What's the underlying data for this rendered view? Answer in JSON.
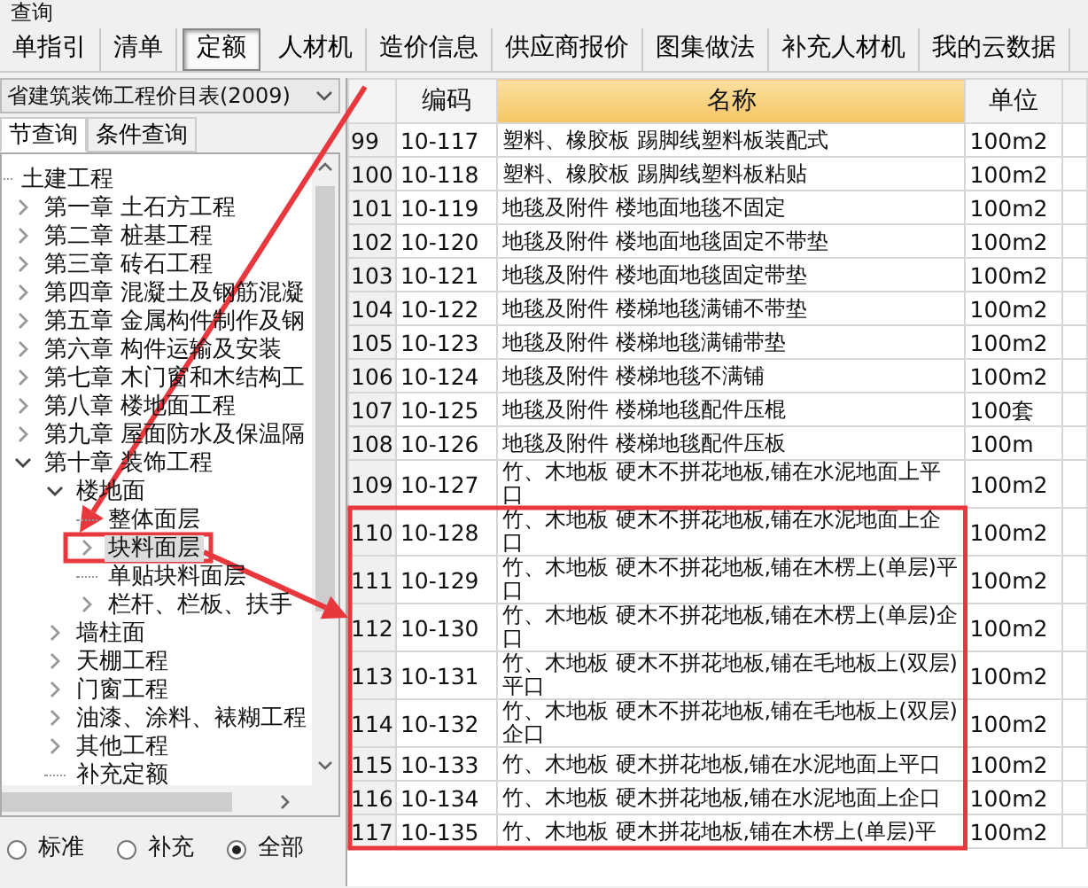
{
  "window": {
    "title": "查询"
  },
  "tabs": [
    {
      "label": "单指引",
      "selected": false
    },
    {
      "label": "清单",
      "selected": false
    },
    {
      "label": "定额",
      "selected": true
    },
    {
      "label": "人材机",
      "selected": false
    },
    {
      "label": "造价信息",
      "selected": false
    },
    {
      "label": "供应商报价",
      "selected": false
    },
    {
      "label": "图集做法",
      "selected": false
    },
    {
      "label": "补充人材机",
      "selected": false
    },
    {
      "label": "我的云数据",
      "selected": false
    }
  ],
  "library": {
    "value": "省建筑装饰工程价目表(2009)"
  },
  "query_tabs": [
    {
      "label": "节查询",
      "selected": true
    },
    {
      "label": "条件查询",
      "selected": false
    }
  ],
  "tree": [
    {
      "label": "土建工程",
      "expanded": true,
      "selected": false,
      "children": [
        {
          "label": "第一章  土石方工程",
          "expanded": false,
          "selected": false
        },
        {
          "label": "第二章  桩基工程",
          "expanded": false,
          "selected": false
        },
        {
          "label": "第三章  砖石工程",
          "expanded": false,
          "selected": false
        },
        {
          "label": "第四章  混凝土及钢筋混凝",
          "expanded": false,
          "selected": false
        },
        {
          "label": "第五章  金属构件制作及钢",
          "expanded": false,
          "selected": false
        },
        {
          "label": "第六章  构件运输及安装",
          "expanded": false,
          "selected": false
        },
        {
          "label": "第七章  木门窗和木结构工",
          "expanded": false,
          "selected": false
        },
        {
          "label": "第八章  楼地面工程",
          "expanded": false,
          "selected": false
        },
        {
          "label": "第九章  屋面防水及保温隔",
          "expanded": false,
          "selected": false
        },
        {
          "label": "第十章  装饰工程",
          "expanded": true,
          "selected": false,
          "children": [
            {
              "label": "楼地面",
              "expanded": true,
              "selected": false,
              "children": [
                {
                  "label": "整体面层",
                  "selected": false
                },
                {
                  "label": "块料面层",
                  "expanded": false,
                  "selected": true,
                  "marked": true
                },
                {
                  "label": "单贴块料面层",
                  "selected": false
                },
                {
                  "label": "栏杆、栏板、扶手",
                  "expanded": false,
                  "selected": false
                }
              ]
            },
            {
              "label": "墙柱面",
              "expanded": false,
              "selected": false
            },
            {
              "label": "天棚工程",
              "expanded": false,
              "selected": false
            },
            {
              "label": "门窗工程",
              "expanded": false,
              "selected": false
            },
            {
              "label": "油漆、涂料、裱糊工程",
              "expanded": false,
              "selected": false
            },
            {
              "label": "其他工程",
              "expanded": false,
              "selected": false
            },
            {
              "label": "补充定额",
              "selected": false
            }
          ]
        }
      ]
    }
  ],
  "filter_options": [
    {
      "label": "标准",
      "selected": false
    },
    {
      "label": "补充",
      "selected": false
    },
    {
      "label": "全部",
      "selected": true
    }
  ],
  "table": {
    "columns": [
      {
        "label": "编码",
        "selected": false
      },
      {
        "label": "名称",
        "selected": true
      },
      {
        "label": "单位",
        "selected": false
      }
    ],
    "rows": [
      {
        "index": "99",
        "code": "10-117",
        "name": "塑料、橡胶板 踢脚线塑料板装配式",
        "unit": "100m2",
        "marked": false
      },
      {
        "index": "100",
        "code": "10-118",
        "name": "塑料、橡胶板 踢脚线塑料板粘贴",
        "unit": "100m2",
        "marked": false
      },
      {
        "index": "101",
        "code": "10-119",
        "name": "地毯及附件 楼地面地毯不固定",
        "unit": "100m2",
        "marked": false
      },
      {
        "index": "102",
        "code": "10-120",
        "name": "地毯及附件 楼地面地毯固定不带垫",
        "unit": "100m2",
        "marked": false
      },
      {
        "index": "103",
        "code": "10-121",
        "name": "地毯及附件 楼地面地毯固定带垫",
        "unit": "100m2",
        "marked": false
      },
      {
        "index": "104",
        "code": "10-122",
        "name": "地毯及附件 楼梯地毯满铺不带垫",
        "unit": "100m2",
        "marked": false
      },
      {
        "index": "105",
        "code": "10-123",
        "name": "地毯及附件 楼梯地毯满铺带垫",
        "unit": "100m2",
        "marked": false
      },
      {
        "index": "106",
        "code": "10-124",
        "name": "地毯及附件 楼梯地毯不满铺",
        "unit": "100m2",
        "marked": false
      },
      {
        "index": "107",
        "code": "10-125",
        "name": "地毯及附件 楼梯地毯配件压棍",
        "unit": "100套",
        "marked": false
      },
      {
        "index": "108",
        "code": "10-126",
        "name": "地毯及附件 楼梯地毯配件压板",
        "unit": "100m",
        "marked": false
      },
      {
        "index": "109",
        "code": "10-127",
        "name": "竹、木地板 硬木不拼花地板,铺在水泥地面上平口",
        "unit": "100m2",
        "marked": false
      },
      {
        "index": "110",
        "code": "10-128",
        "name": "竹、木地板 硬木不拼花地板,铺在水泥地面上企口",
        "unit": "100m2",
        "marked": true
      },
      {
        "index": "111",
        "code": "10-129",
        "name": "竹、木地板 硬木不拼花地板,铺在木楞上(单层)平口",
        "unit": "100m2",
        "marked": true
      },
      {
        "index": "112",
        "code": "10-130",
        "name": "竹、木地板 硬木不拼花地板,铺在木楞上(单层)企口",
        "unit": "100m2",
        "marked": true
      },
      {
        "index": "113",
        "code": "10-131",
        "name": "竹、木地板 硬木不拼花地板,铺在毛地板上(双层)平口",
        "unit": "100m2",
        "marked": true
      },
      {
        "index": "114",
        "code": "10-132",
        "name": "竹、木地板 硬木不拼花地板,铺在毛地板上(双层)企口",
        "unit": "100m2",
        "marked": true
      },
      {
        "index": "115",
        "code": "10-133",
        "name": "竹、木地板 硬木拼花地板,铺在水泥地面上平口",
        "unit": "100m2",
        "marked": true
      },
      {
        "index": "116",
        "code": "10-134",
        "name": "竹、木地板 硬木拼花地板,铺在水泥地面上企口",
        "unit": "100m2",
        "marked": true
      },
      {
        "index": "117",
        "code": "10-135",
        "name": "竹、木地板 硬木拼花地板,铺在木楞上(单层)平",
        "unit": "100m2",
        "marked": true
      }
    ]
  }
}
